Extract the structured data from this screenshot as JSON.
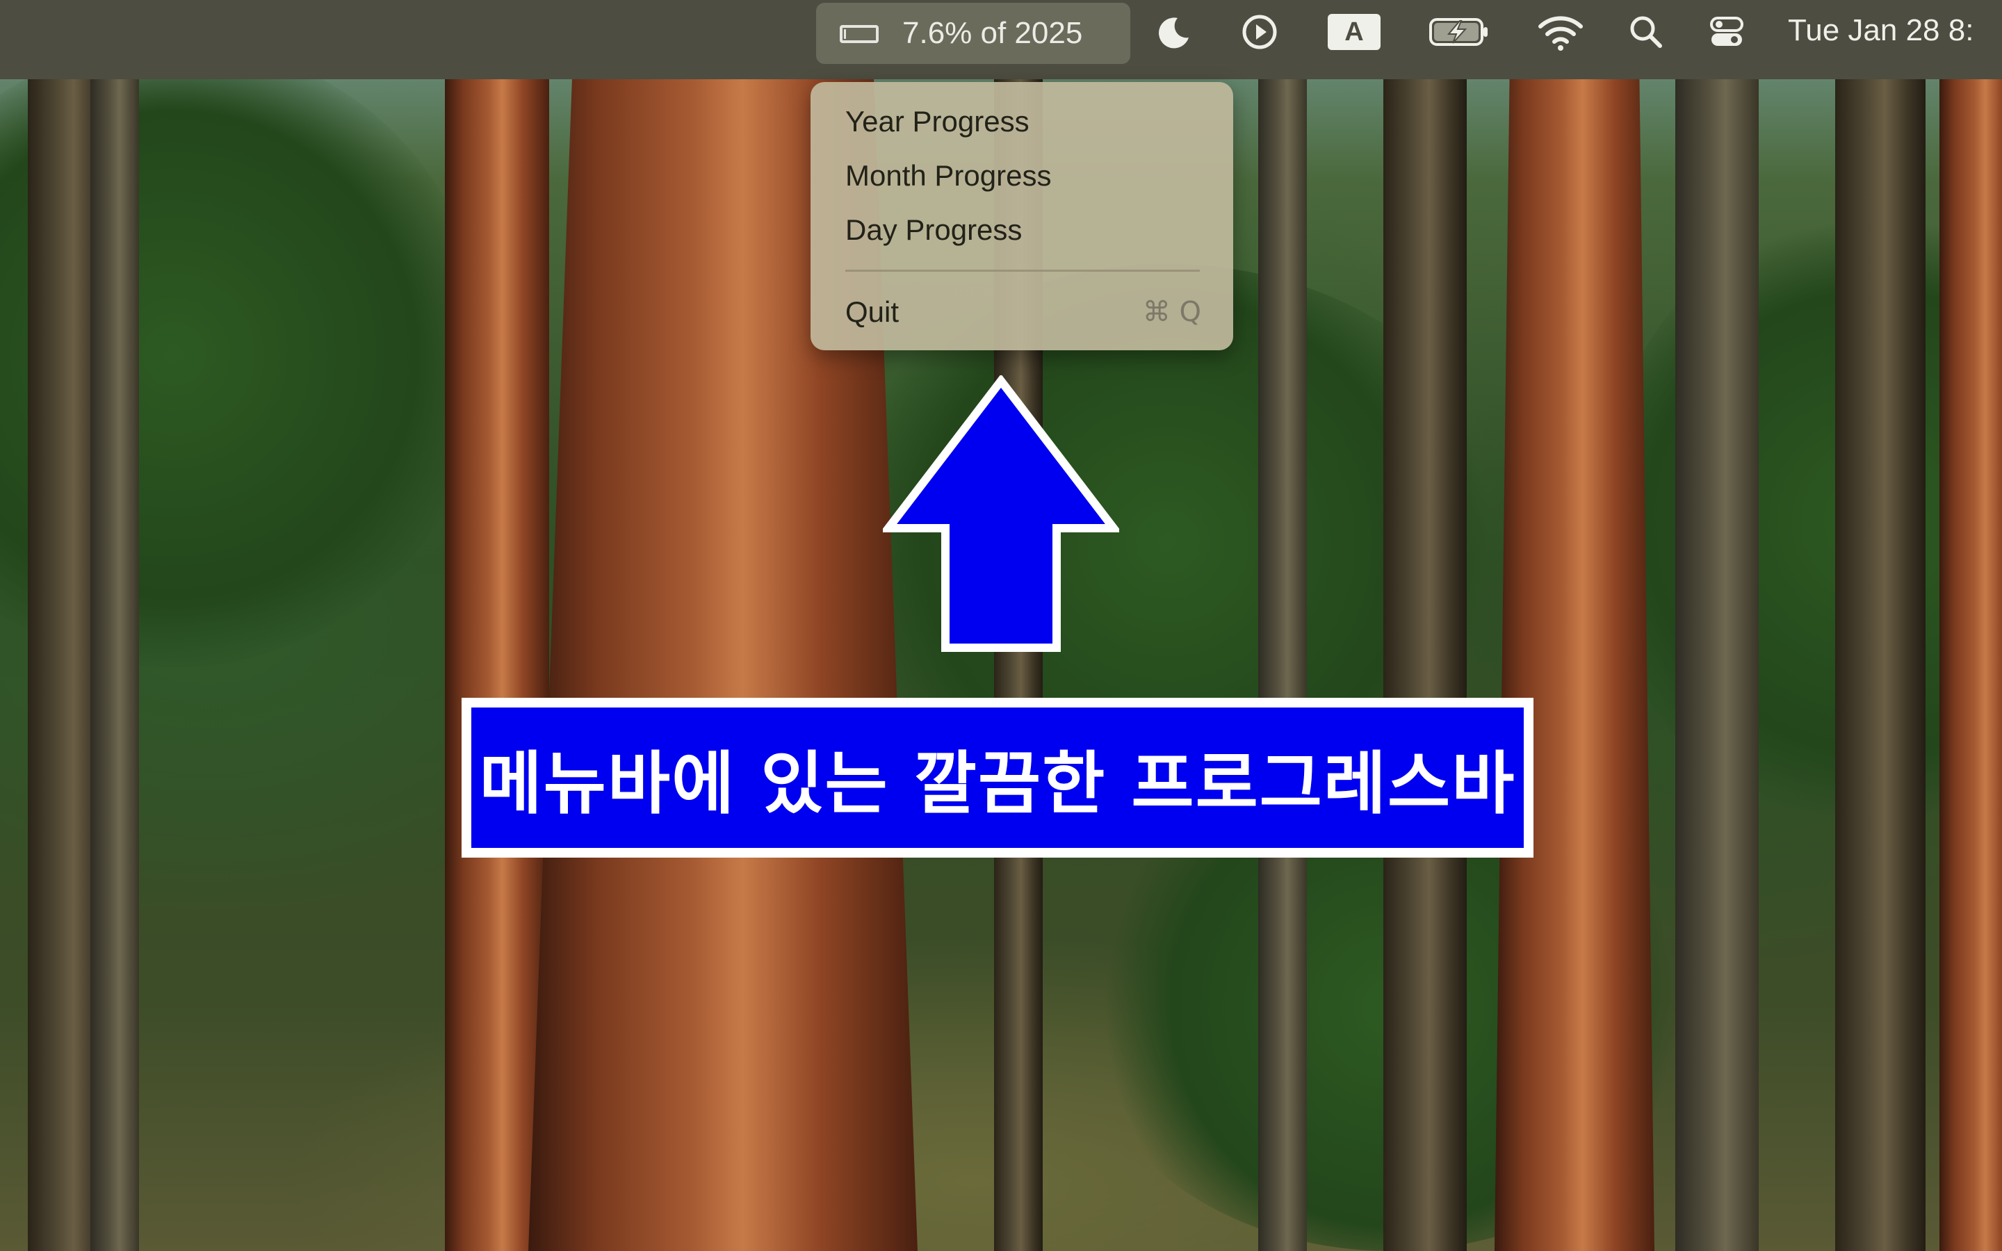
{
  "menubar": {
    "status_item": {
      "label": "7.6% of 2025",
      "progress_fraction": 0.076,
      "icon": "progress-bar-icon"
    },
    "icons": [
      "moon-icon",
      "play-circle-icon",
      "input-source-a-icon",
      "battery-charging-icon",
      "wifi-icon",
      "search-icon",
      "control-center-icon"
    ],
    "input_source_letter": "A",
    "clock": "Tue Jan 28 8:"
  },
  "menu": {
    "items": [
      {
        "label": "Year Progress"
      },
      {
        "label": "Month Progress"
      },
      {
        "label": "Day Progress"
      }
    ],
    "quit": {
      "label": "Quit",
      "shortcut": "⌘ Q"
    }
  },
  "annotation": {
    "caption": "메뉴바에 있는 깔끔한 프로그레스바",
    "arrow_color": "#0000f0",
    "box_color": "#0000f0"
  },
  "colors": {
    "menubar_bg": "#4d4d41",
    "menu_bg": "#c0b89c",
    "menu_text": "#222218"
  }
}
